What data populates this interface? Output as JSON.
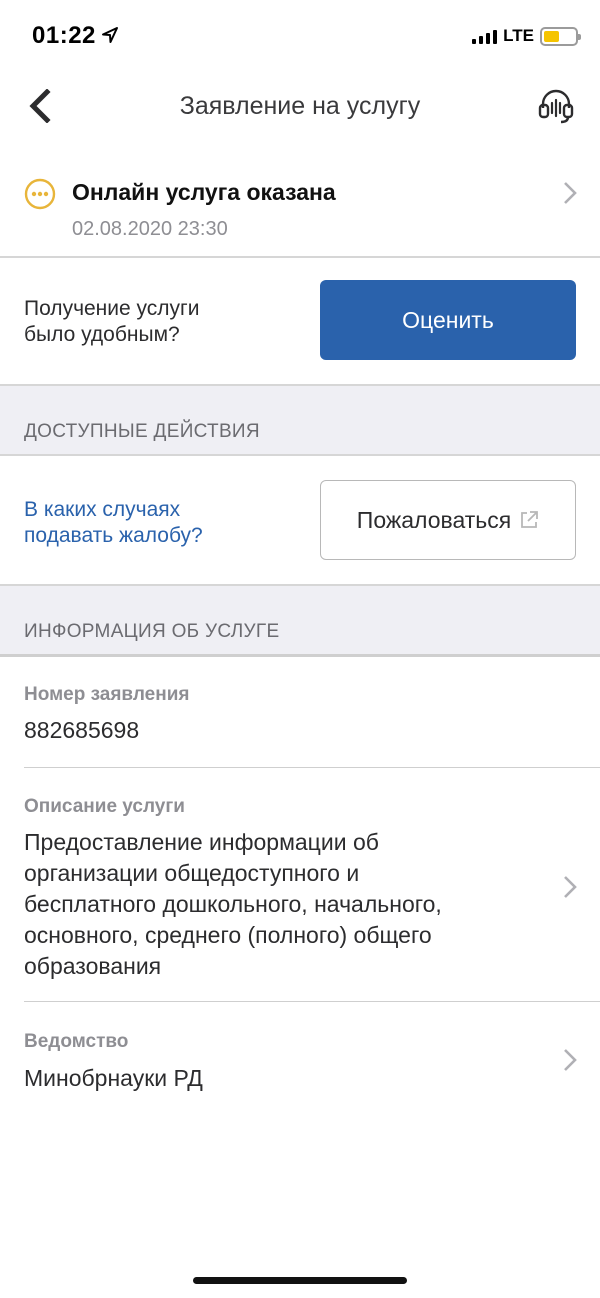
{
  "status_bar": {
    "time": "01:22",
    "network": "LTE",
    "battery_level": 0.5,
    "battery_color": "#f5c400"
  },
  "nav": {
    "title": "Заявление на услугу",
    "back_icon": "chevron-left-icon",
    "support_icon": "headset-icon"
  },
  "status": {
    "icon": "pending-dots-icon",
    "icon_color": "#e8b53a",
    "title": "Онлайн услуга оказана",
    "date": "02.08.2020 23:30"
  },
  "rating": {
    "question_line1": "Получение услуги",
    "question_line2": "было удобным?",
    "button_label": "Оценить",
    "button_color": "#2a62ac"
  },
  "actions": {
    "header": "ДОСТУПНЫЕ ДЕЙСТВИЯ",
    "link_line1": "В каких случаях",
    "link_line2": "подавать жалобу?",
    "complaint_label": "Пожаловаться",
    "complaint_icon": "external-link-icon"
  },
  "info": {
    "header": "ИНФОРМАЦИЯ ОБ УСЛУГЕ",
    "fields": [
      {
        "label": "Номер заявления",
        "value": "882685698"
      },
      {
        "label": "Описание услуги",
        "value_lines": [
          "Предоставление информации об",
          "организации общедоступного и",
          "бесплатного дошкольного, начального,",
          "основного, среднего (полного) общего",
          "образования"
        ]
      },
      {
        "label": "Ведомство",
        "value": "Минобрнауки РД"
      }
    ]
  }
}
